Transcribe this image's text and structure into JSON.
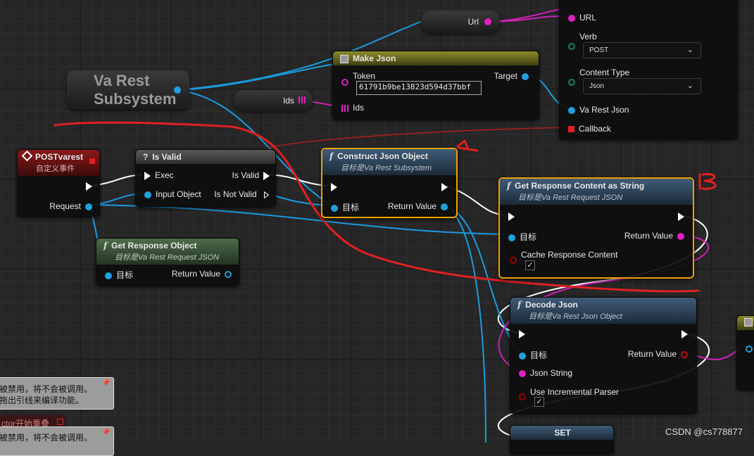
{
  "canvas": {
    "background": "#262626"
  },
  "colors": {
    "object_pin": "#1fa0e0",
    "string_pin": "#e020c0",
    "exec_pin": "#ffffff",
    "bool_pin": "#b00000",
    "selection": "#f0a000",
    "annotation": "#e02020"
  },
  "var_url": {
    "label": "Url"
  },
  "var_ids": {
    "label": "Ids"
  },
  "subsystem": {
    "line1": "Va Rest",
    "line2": "Subsystem"
  },
  "make_json": {
    "title": "Make Json",
    "token_label": "Token",
    "token_value": "61791b9be13823d594d37bbf",
    "target_label": "Target",
    "ids_label": "Ids"
  },
  "request_node": {
    "pin_url": "URL",
    "verb_label": "Verb",
    "verb_value": "POST",
    "content_type_label": "Content Type",
    "content_type_value": "Json",
    "json_pin": "Va Rest Json",
    "callback_pin": "Callback"
  },
  "post_event": {
    "title": "POSTvarest",
    "subtitle": "自定义事件",
    "request_pin": "Request"
  },
  "is_valid": {
    "title": "Is Valid",
    "exec": "Exec",
    "input": "Input Object",
    "out_valid": "Is Valid",
    "out_not_valid": "Is Not Valid"
  },
  "construct_json": {
    "title": "Construct Json Object",
    "subtitle": "目标是Va Rest Subsystem",
    "target": "目标",
    "return": "Return Value"
  },
  "get_response_content": {
    "title": "Get Response Content as String",
    "subtitle": "目标是Va Rest Request JSON",
    "target": "目标",
    "return": "Return Value",
    "cache": "Cache Response Content"
  },
  "get_response_object": {
    "title": "Get Response Object",
    "subtitle": "目标是Va Rest Request JSON",
    "target": "目标",
    "return": "Return Value"
  },
  "decode_json": {
    "title": "Decode Json",
    "subtitle": "目标是Va Rest Json Object",
    "target": "目标",
    "json_string": "Json String",
    "return": "Return Value",
    "incremental": "Use Incremental Parser"
  },
  "set_node": {
    "title": "SET"
  },
  "annotations": {
    "a": "A",
    "b": "B"
  },
  "comments": {
    "c1_line1": "被禁用，将不会被调用。",
    "c1_line2": "拖出引线来编译功能。",
    "c2_title": "ctor开始重叠",
    "c3_line1": "被禁用，将不会被调用。"
  },
  "watermark": "CSDN @cs778877"
}
